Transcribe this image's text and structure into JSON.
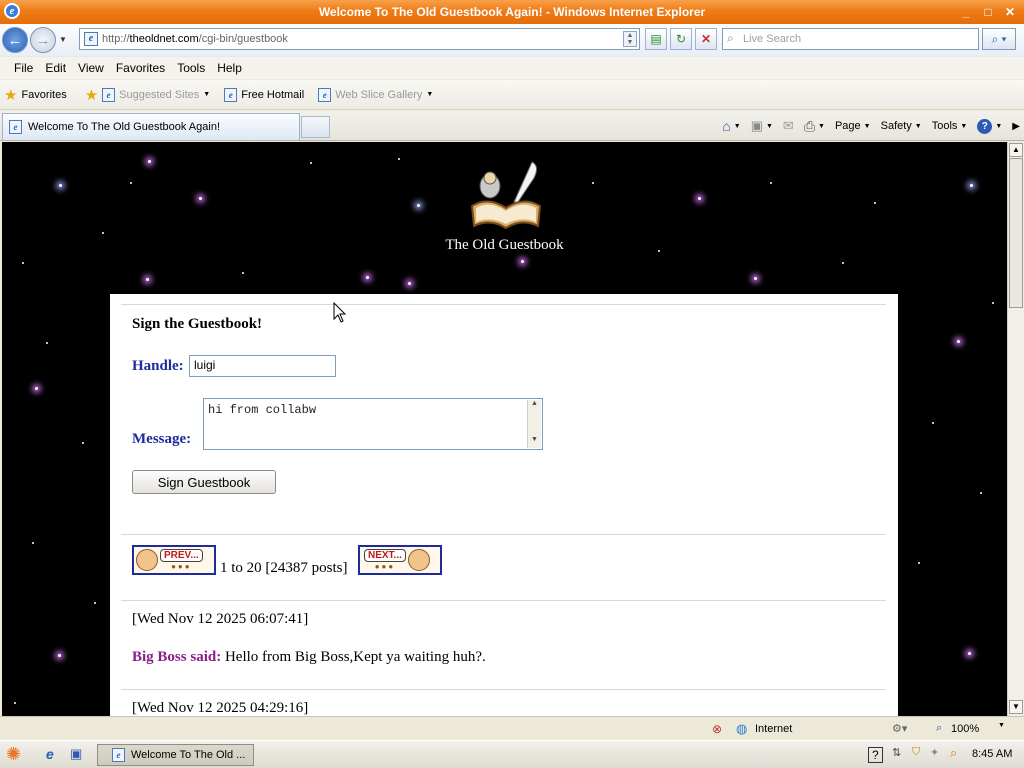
{
  "window": {
    "title": "Welcome To The Old Guestbook Again! - Windows Internet Explorer",
    "controls": [
      "_",
      "□",
      "✕"
    ]
  },
  "address": {
    "url_prefix": "http://",
    "url_domain": "theoldnet.com",
    "url_path": "/cgi-bin/guestbook",
    "search_placeholder": "Live Search"
  },
  "menu": {
    "items": [
      "File",
      "Edit",
      "View",
      "Favorites",
      "Tools",
      "Help"
    ]
  },
  "favorites_bar": {
    "favorites_label": "Favorites",
    "links": [
      "Suggested Sites",
      "Free Hotmail",
      "Web Slice Gallery"
    ]
  },
  "tabs": {
    "active_label": "Welcome To The Old Guestbook Again!"
  },
  "command_bar": {
    "page": "Page",
    "safety": "Safety",
    "tools": "Tools"
  },
  "page": {
    "site_title": "The Old Guestbook",
    "form": {
      "heading": "Sign the Guestbook!",
      "handle_label": "Handle:",
      "handle_value": "luigi",
      "message_label": "Message:",
      "message_value": "hi from collabw",
      "submit_label": "Sign Guestbook"
    },
    "pagination": {
      "prev_label": "PREV...",
      "next_label": "NEXT...",
      "info": "1 to 20 [24387 posts]"
    },
    "posts": [
      {
        "date": "[Wed Nov 12 2025 06:07:41]",
        "author": "Big Boss said:",
        "text": "Hello from Big Boss,Kept ya waiting huh?."
      },
      {
        "date": "[Wed Nov 12 2025 04:29:16]"
      }
    ]
  },
  "status": {
    "zone": "Internet",
    "zoom": "100%"
  },
  "taskbar": {
    "task_label": "Welcome To The Old ...",
    "clock": "8:45 AM"
  }
}
